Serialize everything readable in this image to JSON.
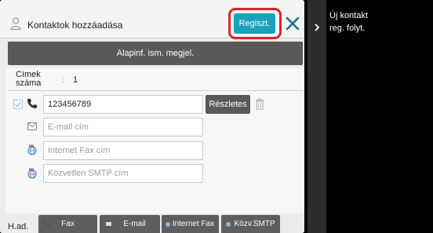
{
  "header": {
    "title": "Kontaktok hozzáadása",
    "register_label": "Regiszt.",
    "close_label": "×"
  },
  "basic_info_button": "Alapinf. ism. megjel.",
  "address_count": {
    "label_line1": "Címek",
    "label_line2": "száma",
    "colon": ":",
    "value": "1"
  },
  "fields": {
    "phone_value": "123456789",
    "email_placeholder": "E-mail cím",
    "internet_fax_placeholder": "Internet Fax cím",
    "smtp_placeholder": "Közvetlen SMTP cím"
  },
  "details_button": "Részletes",
  "footer": {
    "label": "H.ad.",
    "tabs": [
      {
        "label": "Fax"
      },
      {
        "label": "E-mail"
      },
      {
        "label": "Internet Fax"
      },
      {
        "label": "Közv.SMTP"
      }
    ]
  },
  "side_panel": {
    "line1": "Új kontakt",
    "line2": "reg. folyt."
  },
  "colors": {
    "accent": "#19a2bd",
    "highlight_ring": "#e0212b",
    "dark_button": "#595959"
  }
}
